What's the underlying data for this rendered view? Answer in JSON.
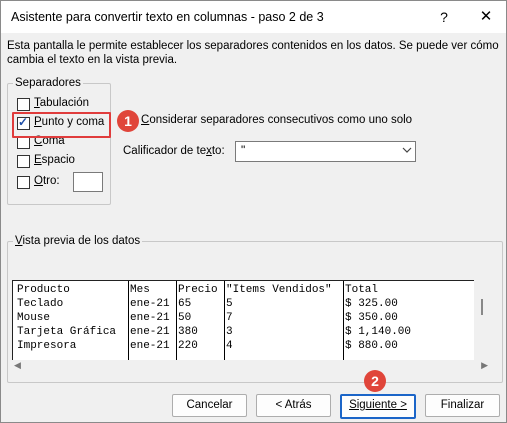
{
  "window": {
    "title": "Asistente para convertir texto en columnas - paso 2 de 3",
    "help_label": "?",
    "close_label": "✕"
  },
  "description": "Esta pantalla le permite establecer los separadores contenidos en los datos. Se puede ver cómo cambia el texto en la vista previa.",
  "separators": {
    "legend": "Separadores",
    "options": [
      {
        "u": "T",
        "rest": "abulación",
        "checked": false
      },
      {
        "u": "P",
        "rest": "unto y coma",
        "checked": true
      },
      {
        "u": "C",
        "rest": "oma",
        "checked": false
      },
      {
        "u": "E",
        "rest": "spacio",
        "checked": false
      },
      {
        "u": "O",
        "rest": "tro:",
        "checked": false
      }
    ],
    "otro_value": ""
  },
  "consecutive": {
    "u": "C",
    "rest": "onsiderar separadores consecutivos como uno solo",
    "checked": false
  },
  "qualifier": {
    "label_pre": "Calificador de te",
    "label_u": "x",
    "label_post": "to:",
    "value": "\""
  },
  "preview": {
    "label_pre": "",
    "label_u": "V",
    "label_post": "ista previa de los datos",
    "columns": [
      [
        "Producto",
        "Teclado",
        "Mouse",
        "Tarjeta Gráfica",
        "Impresora"
      ],
      [
        "Mes",
        "ene-21",
        "ene-21",
        "ene-21",
        "ene-21"
      ],
      [
        "Precio",
        "65",
        "50",
        "380",
        "220"
      ],
      [
        "\"Items Vendidos\"",
        "5",
        "7",
        "3",
        "4"
      ],
      [
        "Total",
        "$ 325.00",
        "$ 350.00",
        "$ 1,140.00",
        "$ 880.00"
      ]
    ]
  },
  "markers": {
    "one": "1",
    "two": "2"
  },
  "buttons": {
    "cancel": "Cancelar",
    "back": "< Atrás",
    "next": "Siguiente >",
    "finish": "Finalizar"
  },
  "colors": {
    "highlight": "#e03c3c",
    "marker": "#e0453a",
    "accent": "#1b65c8"
  }
}
